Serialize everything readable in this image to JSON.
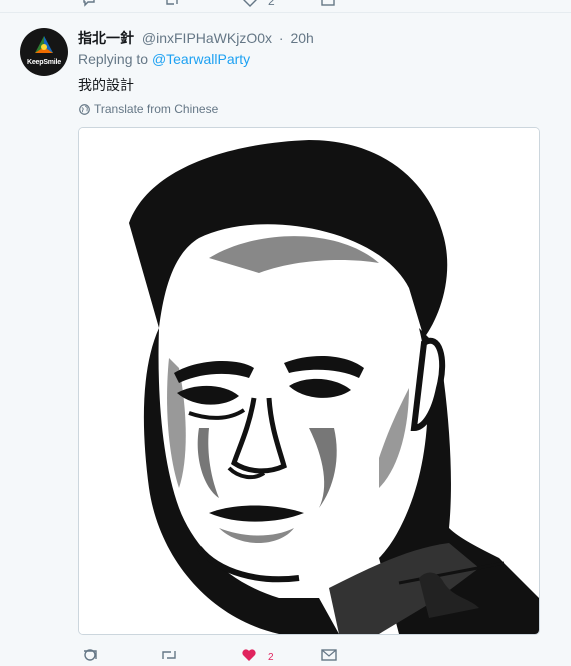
{
  "top_bar": {
    "like_count": "2"
  },
  "tweet": {
    "display_name": "指北一針",
    "handle": "@inxFIPHaWKjzO0x",
    "separator": "·",
    "timestamp": "20h",
    "reply_prefix": "Replying to",
    "reply_to": "@TearwallParty",
    "text": "我的設計",
    "translate_label": "Translate from Chinese",
    "avatar_text": "KeepSmile"
  },
  "actions": {
    "like_count": "2",
    "liked": true,
    "colors": {
      "liked": "#e0245e",
      "icon": "#657786",
      "link": "#1da1f2"
    }
  }
}
